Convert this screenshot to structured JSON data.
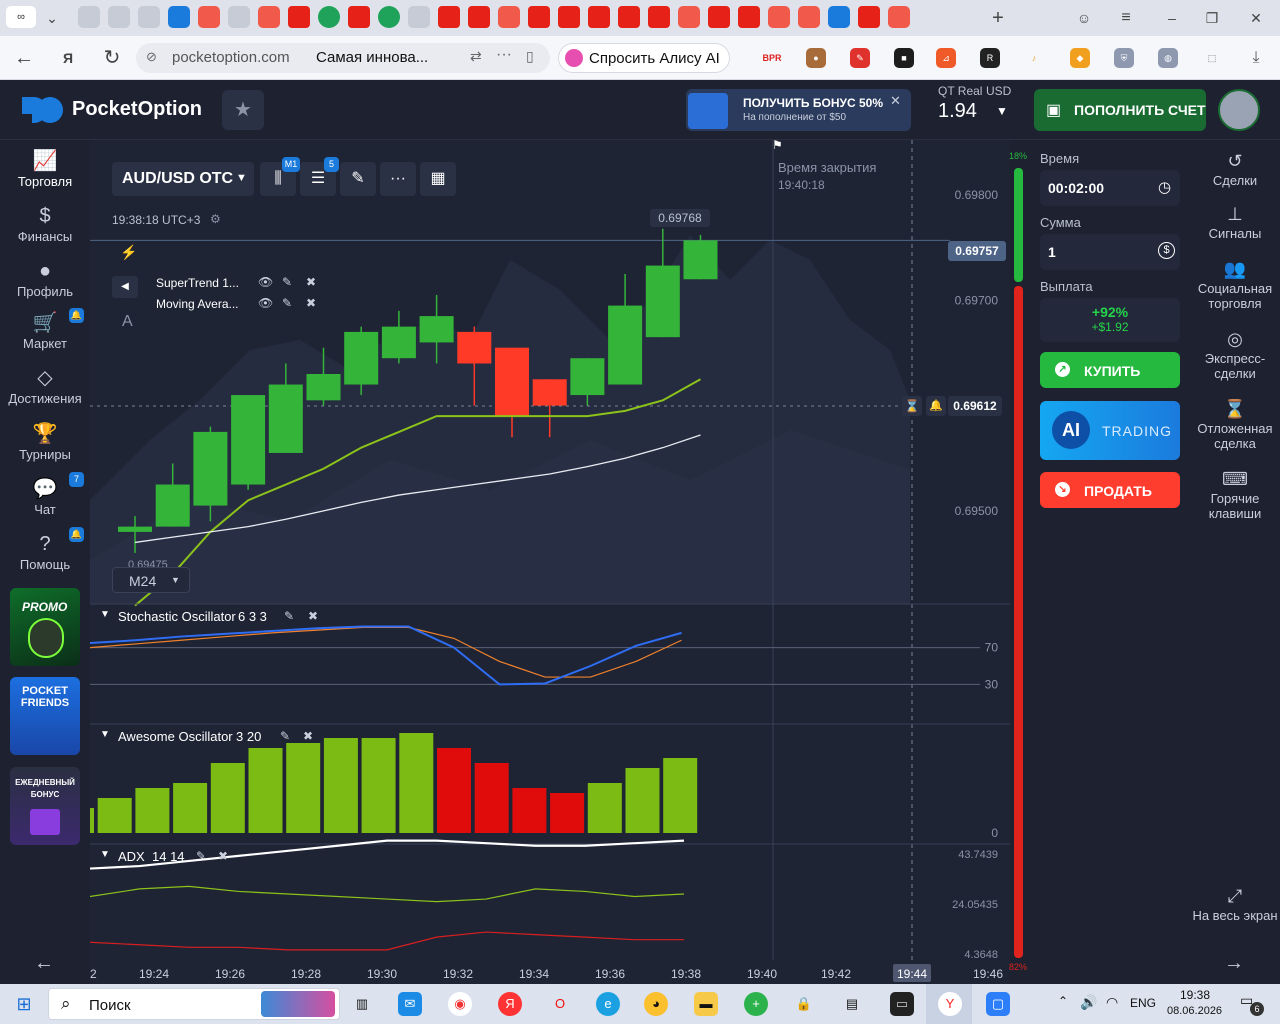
{
  "browser": {
    "url": "pocketoption.com",
    "page_title": "Самая иннова...",
    "alice_label": "Спросить Алису AI",
    "tabs": [
      "∞",
      "",
      "",
      "",
      "",
      "",
      "",
      "",
      "",
      "",
      "",
      "",
      "",
      "",
      "",
      "",
      "",
      "",
      "",
      "",
      "",
      "",
      "",
      "",
      "",
      "",
      "",
      "",
      "",
      "",
      "",
      ""
    ]
  },
  "header": {
    "brand": "PocketOption",
    "bonus_title": "ПОЛУЧИТЬ БОНУС 50%",
    "bonus_sub": "На пополнение от $50",
    "account_type": "QT Real",
    "currency": "USD",
    "balance": "1.94",
    "deposit_label": "ПОПОЛНИТЬ СЧЕТ"
  },
  "left_nav": [
    {
      "label": "Торговля",
      "icon": "chart-icon"
    },
    {
      "label": "Финансы",
      "icon": "dollar-icon"
    },
    {
      "label": "Профиль",
      "icon": "user-icon"
    },
    {
      "label": "Маркет",
      "icon": "cart-icon"
    },
    {
      "label": "Достижения",
      "icon": "diamond-icon"
    },
    {
      "label": "Турниры",
      "icon": "trophy-icon"
    },
    {
      "label": "Чат",
      "icon": "chat-icon"
    },
    {
      "label": "Помощь",
      "icon": "help-icon"
    }
  ],
  "left_badges": {
    "chat": "7"
  },
  "promos": {
    "promo1": "PROMO",
    "promo2": "POCKET FRIENDS",
    "promo3": "ЕЖЕДНЕВНЫЙ БОНУС"
  },
  "chart": {
    "asset": "AUD/USD OTC",
    "timeframe_badge": "M1",
    "indicators_badge": "5",
    "server_time": "19:38:18 UTC+3",
    "close_time_label": "Время закрытия",
    "close_time": "19:40:18",
    "current_price": "0.69757",
    "high_label": "0.69768",
    "marker_price": "0.69612",
    "low_label": "0.69475",
    "zoom": "M24",
    "top_pct": "18%",
    "bottom_pct": "82%",
    "overlays": [
      "SuperTrend 1...",
      "Moving Avera..."
    ],
    "price_ticks": [
      "0.69800",
      "0.69700",
      "0.69500"
    ],
    "time_ticks": [
      "2",
      "19:24",
      "19:26",
      "19:28",
      "19:30",
      "19:32",
      "19:34",
      "19:36",
      "19:38",
      "19:40",
      "19:42",
      "19:44",
      "19:46"
    ],
    "time_highlight": "19:44"
  },
  "chart_data": {
    "type": "candlestick",
    "candles": [
      {
        "o": 0.6948,
        "c": 0.69485,
        "h": 0.69495,
        "l": 0.6946
      },
      {
        "o": 0.69485,
        "c": 0.69525,
        "h": 0.69545,
        "l": 0.69485
      },
      {
        "o": 0.69505,
        "c": 0.69575,
        "h": 0.6958,
        "l": 0.6949
      },
      {
        "o": 0.69525,
        "c": 0.6961,
        "h": 0.6961,
        "l": 0.6952
      },
      {
        "o": 0.69555,
        "c": 0.6962,
        "h": 0.6964,
        "l": 0.69555
      },
      {
        "o": 0.69605,
        "c": 0.6963,
        "h": 0.69655,
        "l": 0.696
      },
      {
        "o": 0.6962,
        "c": 0.6967,
        "h": 0.69675,
        "l": 0.6961
      },
      {
        "o": 0.69645,
        "c": 0.69675,
        "h": 0.6969,
        "l": 0.6964
      },
      {
        "o": 0.6966,
        "c": 0.69685,
        "h": 0.69705,
        "l": 0.6964
      },
      {
        "o": 0.6967,
        "c": 0.6964,
        "h": 0.69675,
        "l": 0.696
      },
      {
        "o": 0.69655,
        "c": 0.6959,
        "h": 0.69655,
        "l": 0.6957
      },
      {
        "o": 0.69625,
        "c": 0.696,
        "h": 0.69625,
        "l": 0.6957
      },
      {
        "o": 0.6961,
        "c": 0.69645,
        "h": 0.69645,
        "l": 0.696
      },
      {
        "o": 0.6962,
        "c": 0.69695,
        "h": 0.69725,
        "l": 0.6962
      },
      {
        "o": 0.69665,
        "c": 0.69733,
        "h": 0.69768,
        "l": 0.69665
      },
      {
        "o": 0.6972,
        "c": 0.69757,
        "h": 0.69762,
        "l": 0.6972
      }
    ],
    "supertrend": [
      0.6941,
      0.6944,
      0.6948,
      0.6951,
      0.69525,
      0.6954,
      0.6956,
      0.69575,
      0.6959,
      0.6959,
      0.6959,
      0.6959,
      0.6959,
      0.69595,
      0.69605,
      0.69625
    ],
    "moving_average": [
      0.6947,
      0.69475,
      0.6948,
      0.69485,
      0.69492,
      0.695,
      0.69508,
      0.69515,
      0.6952,
      0.69525,
      0.6953,
      0.69535,
      0.69542,
      0.6955,
      0.6956,
      0.69572
    ],
    "stochastic": {
      "name": "Stochastic Oscillator",
      "params": "6 3 3",
      "levels": [
        70,
        30
      ],
      "k": [
        75,
        78,
        82,
        85,
        88,
        91,
        93,
        93,
        70,
        30,
        31,
        50,
        72,
        86
      ],
      "d": [
        70,
        74,
        78,
        82,
        86,
        89,
        92,
        92,
        80,
        55,
        38,
        38,
        55,
        78
      ]
    },
    "awesome": {
      "name": "Awesome Oscillator",
      "params": "3 20",
      "zero_label": "0",
      "values": [
        5e-05,
        7e-05,
        9e-05,
        0.0001,
        0.00014,
        0.00017,
        0.00018,
        0.00019,
        0.00019,
        0.0002,
        0.00017,
        0.00014,
        9e-05,
        8e-05,
        0.0001,
        0.00013,
        0.00015
      ],
      "colors": [
        "#7cbb14",
        "#7cbb14",
        "#7cbb14",
        "#7cbb14",
        "#7cbb14",
        "#7cbb14",
        "#7cbb14",
        "#7cbb14",
        "#7cbb14",
        "#7cbb14",
        "#e00c0c",
        "#e00c0c",
        "#e00c0c",
        "#e00c0c",
        "#7cbb14",
        "#7cbb14",
        "#7cbb14"
      ]
    },
    "adx": {
      "name": "ADX",
      "params": "14 14",
      "ticks": [
        "43.7439",
        "24.05435",
        "4.3648"
      ],
      "adx": [
        38,
        39,
        41,
        43,
        45,
        47,
        49,
        49,
        48,
        47,
        47,
        48,
        49
      ],
      "plus": [
        27,
        30,
        31,
        29,
        28,
        27,
        26,
        25,
        26,
        30,
        29,
        27,
        28
      ],
      "minus": [
        9,
        8,
        7,
        7,
        6,
        6,
        6,
        11,
        13,
        12,
        11,
        10,
        10
      ]
    }
  },
  "trade": {
    "time_label": "Время",
    "time_value": "00:02:00",
    "amount_label": "Сумма",
    "amount_value": "1",
    "payout_label": "Выплата",
    "payout_pct": "+92%",
    "payout_amount": "+$1.92",
    "buy_label": "КУПИТЬ",
    "ai_label": "AI",
    "ai_trading": "TRADING",
    "sell_label": "ПРОДАТЬ"
  },
  "right_nav": [
    "Сделки",
    "Сигналы",
    "Социальная торговля",
    "Экспресс-сделки",
    "Отложенная сделка",
    "Горячие клавиши",
    "На весь экран"
  ],
  "taskbar": {
    "search": "Поиск",
    "lang": "ENG",
    "time": "19:38",
    "date": "08.06.2026",
    "notif": "6"
  },
  "colors": {
    "bg": "#1d2130",
    "green": "#25b940",
    "red": "#ff3d2e",
    "accent": "#1b7bdd"
  }
}
